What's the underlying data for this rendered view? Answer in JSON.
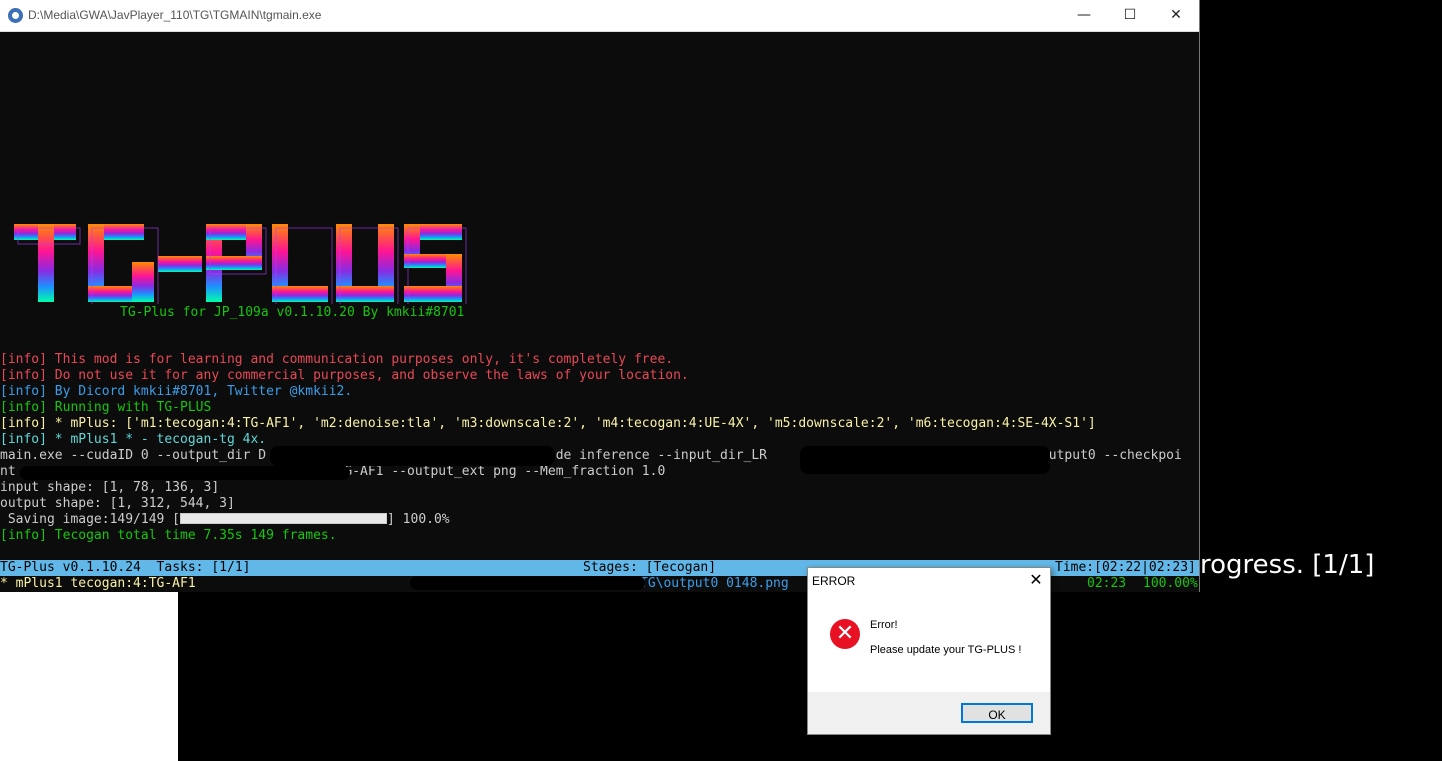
{
  "window": {
    "title": "D:\\Media\\GWA\\JavPlayer_110\\TG\\TGMAIN\\tgmain.exe",
    "minimize_label": "—",
    "maximize_label": "☐",
    "close_label": "✕"
  },
  "logo": {
    "caption": "TG-Plus for JP_109a v0.1.10.20 By kmkii#8701"
  },
  "console": {
    "lines": [
      "[info] This mod is for learning and communication purposes only, it's completely free.",
      "[info] Do not use it for any commercial purposes, and observe the laws of your location.",
      "[info] By Dicord kmkii#8701, Twitter @kmkii2.",
      "[info] Running with TG-PLUS",
      "[info] * mPlus: ['m1:tecogan:4:TG-AF1', 'm2:denoise:tla', 'm3:downscale:2', 'm4:tecogan:4:UE-4X', 'm5:downscale:2', 'm6:tecogan:4:SE-4X-S1']",
      "[info] * mPlus1 * - tecogan-tg 4x.",
      "main.exe --cudaID 0 --output_dir D                              t0 --mode inference --input_dir_LR                                   output0 --checkpoi",
      "nt                                          G-AF1 --output_ext png --Mem_fraction 1.0",
      "input shape: [1, 78, 136, 3]",
      "output shape: [1, 312, 544, 3]",
      " Saving image:149/149 [",
      "[info] Tecogan total time 7.35s 149 frames."
    ],
    "progress_percent_text": "] 100.0%",
    "progress_fraction": 1.0
  },
  "status_bar": {
    "version": "TG-Plus v0.1.10.24",
    "tasks": "Tasks: [1/1]",
    "stages": "Stages: [Tecogan]",
    "time": "Time:[02:22|02:23]",
    "task_name": "* mPlus1 tecogan:4:TG-AF1",
    "path": "TG\\output0 0148.png",
    "elapsed": "02:23",
    "percent": "100.00%"
  },
  "behind_window_text": "rogress. [1/1]",
  "dialog": {
    "title": "ERROR",
    "close_label": "✕",
    "icon": "error-icon",
    "message_title": "Error!",
    "message": "Please update your TG-PLUS !",
    "ok_label": "OK"
  },
  "colors": {
    "info_red": "#e74856",
    "info_blue": "#3b9de8",
    "info_green": "#16c60c",
    "info_yellow": "#f9f1a5",
    "status_bar_bg": "#61b8e8",
    "error_red": "#e81123"
  }
}
